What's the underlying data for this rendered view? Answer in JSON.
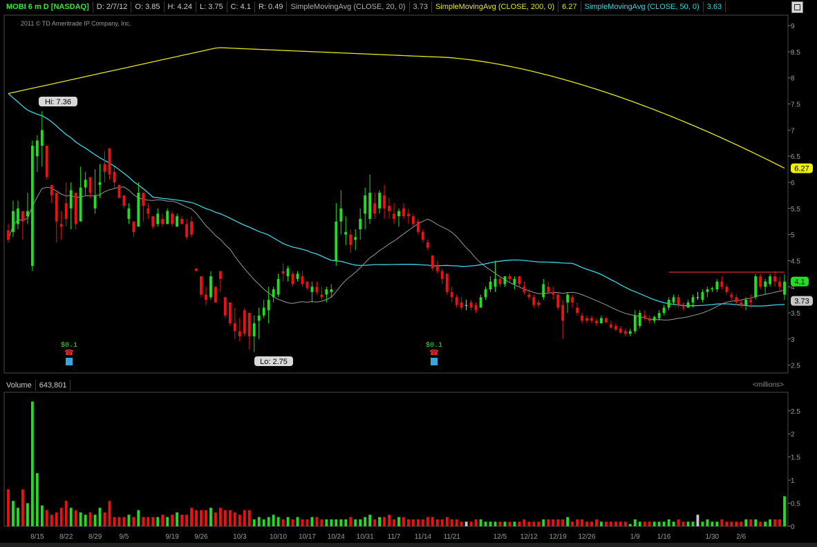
{
  "header": {
    "symbol": "MOBI 6 m D [NASDAQ]",
    "date": "D: 2/7/12",
    "open": "O: 3.85",
    "high": "H: 4.24",
    "low": "L: 3.75",
    "close": "C: 4.1",
    "range": "R: 0.49",
    "studies": [
      {
        "label": "SimpleMovingAvg (CLOSE, 20, 0)",
        "value": "3.73",
        "color": "#b0b0b0"
      },
      {
        "label": "SimpleMovingAvg (CLOSE, 200, 0)",
        "value": "6.27",
        "color": "#e6e619"
      },
      {
        "label": "SimpleMovingAvg (CLOSE, 50, 0)",
        "value": "3.63",
        "color": "#38d7e8"
      }
    ]
  },
  "copyright": "2011 © TD Ameritrade IP Company, Inc.",
  "volume_header": {
    "label": "Volume",
    "value": "643,801",
    "unit": "<millions>"
  },
  "colors": {
    "up": "#22dd22",
    "down": "#ee1111",
    "neutral": "#c8c8c8",
    "ma20": "#9a9a9a",
    "ma200": "#e6e619",
    "ma50": "#38d7e8",
    "resistance": "#c0282d"
  },
  "chart_data": {
    "type": "candlestick",
    "x_ticks": [
      "8/15",
      "8/22",
      "8/29",
      "9/5",
      "9/19",
      "9/26",
      "10/3",
      "10/10",
      "10/17",
      "10/24",
      "10/31",
      "11/7",
      "11/14",
      "11/21",
      "12/5",
      "12/12",
      "12/19",
      "12/26",
      "1/9",
      "1/16",
      "1/30",
      "2/6"
    ],
    "price_ticks": [
      2.5,
      3,
      3.5,
      4,
      4.5,
      5,
      5.5,
      6,
      6.5,
      7,
      7.5,
      8,
      8.5,
      9
    ],
    "price_range": [
      2.35,
      9.2
    ],
    "volume_ticks": [
      0,
      0.5,
      1,
      1.5,
      2,
      2.5
    ],
    "volume_range": [
      0,
      2.9
    ],
    "labels": {
      "hi": "Hi: 7.36",
      "lo": "Lo: 2.75",
      "last_close": "4.1",
      "ma20_last": "3.73",
      "ma200_last": "6.27"
    },
    "dividends": [
      "$0.1",
      "$0.1"
    ],
    "candles": [
      [
        5.08,
        5.2,
        4.85,
        4.9,
        0.8
      ],
      [
        5.05,
        5.65,
        4.95,
        5.45,
        0.55
      ],
      [
        5.2,
        5.65,
        5.1,
        5.5,
        0.4
      ],
      [
        5.45,
        5.45,
        4.9,
        5.25,
        0.8
      ],
      [
        5.35,
        5.8,
        5.2,
        5.45,
        0.5
      ],
      [
        4.4,
        6.8,
        4.3,
        6.7,
        2.7
      ],
      [
        6.5,
        6.9,
        6.2,
        6.8,
        1.15
      ],
      [
        6.7,
        7.36,
        6.3,
        7.0,
        0.45
      ],
      [
        6.7,
        6.7,
        6.05,
        6.1,
        0.35
      ],
      [
        5.95,
        5.95,
        5.6,
        5.75,
        0.25
      ],
      [
        5.8,
        5.8,
        4.85,
        5.25,
        0.3
      ],
      [
        5.2,
        5.45,
        4.9,
        5.15,
        0.4
      ],
      [
        5.6,
        6.0,
        5.15,
        5.3,
        0.55
      ],
      [
        5.5,
        6.0,
        5.1,
        5.85,
        0.4
      ],
      [
        5.8,
        5.8,
        5.1,
        5.2,
        0.35
      ],
      [
        5.25,
        6.3,
        5.25,
        5.9,
        0.3
      ],
      [
        5.9,
        6.2,
        5.75,
        6.05,
        0.25
      ],
      [
        6.1,
        6.1,
        5.7,
        5.8,
        0.3
      ],
      [
        5.5,
        6.25,
        5.4,
        5.75,
        0.25
      ],
      [
        5.95,
        6.35,
        5.7,
        6.0,
        0.4
      ],
      [
        6.35,
        6.6,
        6.0,
        6.2,
        0.3
      ],
      [
        6.65,
        6.65,
        6.05,
        6.15,
        0.55
      ],
      [
        6.2,
        6.3,
        5.9,
        6.0,
        0.2
      ],
      [
        5.95,
        5.95,
        5.7,
        5.7,
        0.2
      ],
      [
        5.75,
        5.75,
        5.5,
        5.55,
        0.2
      ],
      [
        5.3,
        5.6,
        5.2,
        5.5,
        0.25
      ],
      [
        5.25,
        5.25,
        4.95,
        5.05,
        0.2
      ],
      [
        5.15,
        6.0,
        5.2,
        5.8,
        0.35
      ],
      [
        5.8,
        5.8,
        5.25,
        5.55,
        0.2
      ],
      [
        5.5,
        5.6,
        5.3,
        5.4,
        0.2
      ],
      [
        5.35,
        5.35,
        5.1,
        5.15,
        0.2
      ],
      [
        5.2,
        5.5,
        5.15,
        5.4,
        0.2
      ],
      [
        5.3,
        5.4,
        5.15,
        5.2,
        0.25
      ],
      [
        5.2,
        5.5,
        5.25,
        5.45,
        0.2
      ],
      [
        5.4,
        5.45,
        5.15,
        5.2,
        0.25
      ],
      [
        5.15,
        5.4,
        5.15,
        5.35,
        0.3
      ],
      [
        5.3,
        5.35,
        5.2,
        5.2,
        0.25
      ],
      [
        5.2,
        5.3,
        4.9,
        4.95,
        0.25
      ],
      [
        5.25,
        5.35,
        4.95,
        5.0,
        0.4
      ],
      [
        4.35,
        4.35,
        4.3,
        4.3,
        0.35
      ],
      [
        4.2,
        4.2,
        3.8,
        3.85,
        0.35
      ],
      [
        3.85,
        4.0,
        3.65,
        3.75,
        0.35
      ],
      [
        3.8,
        4.3,
        3.75,
        4.2,
        0.4
      ],
      [
        4.0,
        4.0,
        3.7,
        3.7,
        0.3
      ],
      [
        4.3,
        4.3,
        3.9,
        4.15,
        0.4
      ],
      [
        3.8,
        3.8,
        3.4,
        3.45,
        0.35
      ],
      [
        3.7,
        3.7,
        3.25,
        3.3,
        0.35
      ],
      [
        3.3,
        3.6,
        3.0,
        3.15,
        0.3
      ],
      [
        3.15,
        3.4,
        2.95,
        3.05,
        0.25
      ],
      [
        3.55,
        3.6,
        3.05,
        3.1,
        0.35
      ],
      [
        3.5,
        3.5,
        2.8,
        3.05,
        0.35
      ],
      [
        3.05,
        3.45,
        2.75,
        3.3,
        0.15
      ],
      [
        3.35,
        3.6,
        3.0,
        3.45,
        0.2
      ],
      [
        3.45,
        3.75,
        3.4,
        3.6,
        0.15
      ],
      [
        3.55,
        4.0,
        3.3,
        3.75,
        0.2
      ],
      [
        3.8,
        4.0,
        3.7,
        3.95,
        0.25
      ],
      [
        3.85,
        4.25,
        3.8,
        4.15,
        0.2
      ],
      [
        4.3,
        4.45,
        4.1,
        4.25,
        0.15
      ],
      [
        4.2,
        4.4,
        4.1,
        4.35,
        0.2
      ],
      [
        4.25,
        4.3,
        4.0,
        4.05,
        0.15
      ],
      [
        4.15,
        4.3,
        4.1,
        4.25,
        0.2
      ],
      [
        4.2,
        4.3,
        4.0,
        4.05,
        0.15
      ],
      [
        4.1,
        4.1,
        3.95,
        3.98,
        0.15
      ],
      [
        3.9,
        4.1,
        3.7,
        4.0,
        0.2
      ],
      [
        4.0,
        4.1,
        3.85,
        3.9,
        0.2
      ],
      [
        3.85,
        4.0,
        3.75,
        3.8,
        0.15
      ],
      [
        3.85,
        4.0,
        3.7,
        3.95,
        0.15
      ],
      [
        3.9,
        4.05,
        3.8,
        3.95,
        0.15
      ],
      [
        4.5,
        5.6,
        4.4,
        5.25,
        0.15
      ],
      [
        5.25,
        5.85,
        5.0,
        5.5,
        0.15
      ],
      [
        5.0,
        5.35,
        4.8,
        5.05,
        0.15
      ],
      [
        5.0,
        5.1,
        4.65,
        4.8,
        0.2
      ],
      [
        4.9,
        5.1,
        4.7,
        4.95,
        0.15
      ],
      [
        5.1,
        5.5,
        4.9,
        5.3,
        0.15
      ],
      [
        5.4,
        5.9,
        5.1,
        5.75,
        0.2
      ],
      [
        5.3,
        6.15,
        5.2,
        5.8,
        0.25
      ],
      [
        5.6,
        5.8,
        5.3,
        5.4,
        0.15
      ],
      [
        5.5,
        5.85,
        5.4,
        5.8,
        0.2
      ],
      [
        5.75,
        5.95,
        5.3,
        5.5,
        0.2
      ],
      [
        5.55,
        5.7,
        5.3,
        5.45,
        0.25
      ],
      [
        5.4,
        5.6,
        5.2,
        5.3,
        0.15
      ],
      [
        5.35,
        5.5,
        5.15,
        5.45,
        0.2
      ],
      [
        5.5,
        5.6,
        5.3,
        5.35,
        0.2
      ],
      [
        5.4,
        5.5,
        5.2,
        5.35,
        0.15
      ],
      [
        5.35,
        5.4,
        5.15,
        5.2,
        0.15
      ],
      [
        5.25,
        5.3,
        5.0,
        5.05,
        0.15
      ],
      [
        5.05,
        5.1,
        4.85,
        4.9,
        0.15
      ],
      [
        4.85,
        4.9,
        4.7,
        4.75,
        0.2
      ],
      [
        4.6,
        4.6,
        4.3,
        4.35,
        0.2
      ],
      [
        4.4,
        4.5,
        4.25,
        4.3,
        0.15
      ],
      [
        4.3,
        4.35,
        4.05,
        4.15,
        0.15
      ],
      [
        4.25,
        4.25,
        3.85,
        3.9,
        0.2
      ],
      [
        3.9,
        4.0,
        3.7,
        3.8,
        0.15
      ],
      [
        3.8,
        3.85,
        3.6,
        3.65,
        0.15
      ],
      [
        3.7,
        3.8,
        3.55,
        3.6,
        0.1
      ],
      [
        3.65,
        3.75,
        3.55,
        3.65,
        0.1
      ],
      [
        3.7,
        3.75,
        3.55,
        3.6,
        0.1
      ],
      [
        3.65,
        3.7,
        3.5,
        3.55,
        0.15
      ],
      [
        3.6,
        3.85,
        3.6,
        3.8,
        0.15
      ],
      [
        3.8,
        4.0,
        3.75,
        3.95,
        0.1
      ],
      [
        3.95,
        4.2,
        3.9,
        4.1,
        0.1
      ],
      [
        4.0,
        4.5,
        3.9,
        4.15,
        0.1
      ],
      [
        4.15,
        4.2,
        4.0,
        4.05,
        0.1
      ],
      [
        4.05,
        4.2,
        4.0,
        4.2,
        0.1
      ],
      [
        4.2,
        4.25,
        4.1,
        4.15,
        0.1
      ],
      [
        4.05,
        4.2,
        3.95,
        4.15,
        0.1
      ],
      [
        4.2,
        4.2,
        4.0,
        4.05,
        0.1
      ],
      [
        4.0,
        4.1,
        3.85,
        3.9,
        0.15
      ],
      [
        3.85,
        3.95,
        3.75,
        3.8,
        0.1
      ],
      [
        3.8,
        3.85,
        3.6,
        3.65,
        0.1
      ],
      [
        3.7,
        3.75,
        3.6,
        3.65,
        0.1
      ],
      [
        3.8,
        4.15,
        3.75,
        4.05,
        0.15
      ],
      [
        4.0,
        4.1,
        3.85,
        3.9,
        0.15
      ],
      [
        3.9,
        4.0,
        3.75,
        3.85,
        0.15
      ],
      [
        3.85,
        3.9,
        3.55,
        3.6,
        0.15
      ],
      [
        3.65,
        3.75,
        3.0,
        3.35,
        0.15
      ],
      [
        3.7,
        3.9,
        3.5,
        3.85,
        0.2
      ],
      [
        3.8,
        3.85,
        3.6,
        3.7,
        0.1
      ],
      [
        3.6,
        3.7,
        3.45,
        3.5,
        0.15
      ],
      [
        3.45,
        3.5,
        3.3,
        3.35,
        0.15
      ],
      [
        3.4,
        3.45,
        3.3,
        3.35,
        0.1
      ],
      [
        3.4,
        3.45,
        3.3,
        3.35,
        0.1
      ],
      [
        3.35,
        3.4,
        3.25,
        3.3,
        0.15
      ],
      [
        3.3,
        3.45,
        3.3,
        3.4,
        0.1
      ],
      [
        3.4,
        3.42,
        3.3,
        3.32,
        0.1
      ],
      [
        3.28,
        3.35,
        3.2,
        3.22,
        0.1
      ],
      [
        3.25,
        3.3,
        3.15,
        3.18,
        0.1
      ],
      [
        3.2,
        3.25,
        3.1,
        3.12,
        0.1
      ],
      [
        3.15,
        3.2,
        3.05,
        3.1,
        0.1
      ],
      [
        3.1,
        3.2,
        3.05,
        3.15,
        0.05
      ],
      [
        3.15,
        3.55,
        3.1,
        3.45,
        0.15
      ],
      [
        3.25,
        3.55,
        3.2,
        3.5,
        0.1
      ],
      [
        3.45,
        3.55,
        3.35,
        3.4,
        0.1
      ],
      [
        3.4,
        3.45,
        3.3,
        3.35,
        0.1
      ],
      [
        3.35,
        3.45,
        3.3,
        3.42,
        0.1
      ],
      [
        3.4,
        3.55,
        3.35,
        3.5,
        0.1
      ],
      [
        3.5,
        3.65,
        3.45,
        3.6,
        0.1
      ],
      [
        3.6,
        3.8,
        3.55,
        3.75,
        0.15
      ],
      [
        3.7,
        3.85,
        3.65,
        3.8,
        0.1
      ],
      [
        3.8,
        3.85,
        3.6,
        3.65,
        0.15
      ],
      [
        3.62,
        3.7,
        3.55,
        3.6,
        0.1
      ],
      [
        3.6,
        3.75,
        3.6,
        3.7,
        0.1
      ],
      [
        3.7,
        3.85,
        3.6,
        3.8,
        0.1
      ],
      [
        3.8,
        3.9,
        3.75,
        3.8,
        0.25
      ],
      [
        3.75,
        3.95,
        3.7,
        3.9,
        0.1
      ],
      [
        3.9,
        4.0,
        3.8,
        3.95,
        0.15
      ],
      [
        3.95,
        4.0,
        3.9,
        3.97,
        0.1
      ],
      [
        3.95,
        4.15,
        3.9,
        4.1,
        0.1
      ],
      [
        4.1,
        4.2,
        3.95,
        4.0,
        0.15
      ],
      [
        4.0,
        4.05,
        3.85,
        3.9,
        0.1
      ],
      [
        3.85,
        3.9,
        3.75,
        3.8,
        0.1
      ],
      [
        3.8,
        3.85,
        3.65,
        3.7,
        0.1
      ],
      [
        3.7,
        3.75,
        3.6,
        3.65,
        0.1
      ],
      [
        3.65,
        3.8,
        3.55,
        3.75,
        0.15
      ],
      [
        3.75,
        3.85,
        3.6,
        3.7,
        0.15
      ],
      [
        3.8,
        4.25,
        3.75,
        4.2,
        0.15
      ],
      [
        4.2,
        4.25,
        3.95,
        4.0,
        0.1
      ],
      [
        4.0,
        4.15,
        3.85,
        4.1,
        0.1
      ],
      [
        4.05,
        4.25,
        4.0,
        4.2,
        0.15
      ],
      [
        4.2,
        4.3,
        4.0,
        4.1,
        0.15
      ],
      [
        4.1,
        4.2,
        3.9,
        4.0,
        0.15
      ],
      [
        3.85,
        4.24,
        3.75,
        4.1,
        0.65
      ]
    ]
  }
}
